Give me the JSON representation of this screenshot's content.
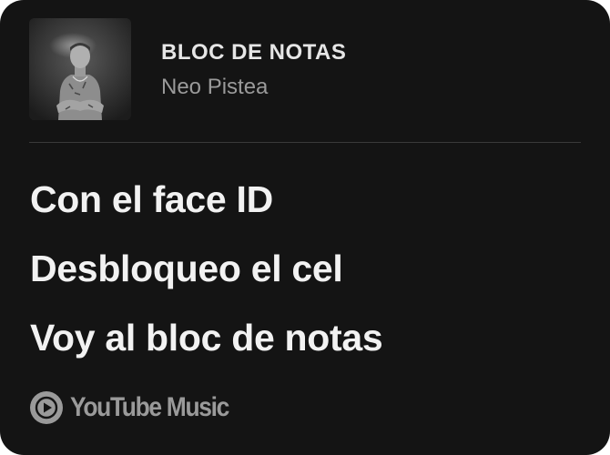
{
  "track": {
    "title": "BLOC DE NOTAS",
    "artist": "Neo Pistea",
    "album_art_icon": "album-cover-artist-photo"
  },
  "lyrics": [
    "Con el face ID",
    "Desbloqueo el cel",
    "Voy al bloc de notas"
  ],
  "brand": {
    "name": "YouTube Music",
    "icon": "youtube-music-logo-icon"
  },
  "colors": {
    "card_background": "#141414",
    "title_text": "#e6e6e6",
    "secondary_text": "#9a9a9a",
    "lyric_text": "#f2f2f2",
    "divider": "#3a3a3a"
  }
}
